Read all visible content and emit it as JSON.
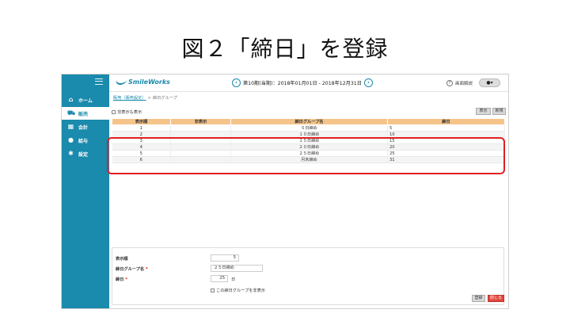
{
  "slide": {
    "title": "図２「締日」を登録"
  },
  "sidebar": {
    "items": [
      {
        "label": "ホーム",
        "icon": "home-icon"
      },
      {
        "label": "販売",
        "icon": "cart-icon"
      },
      {
        "label": "会計",
        "icon": "calculator-icon"
      },
      {
        "label": "給与",
        "icon": "money-bag-icon"
      },
      {
        "label": "設定",
        "icon": "gear-icon"
      }
    ],
    "active_index": 1
  },
  "header": {
    "logo": "SmileWorks",
    "period": "第10期(当期)：2018年01月01日 - 2018年12月31日",
    "help_label": "画面解説",
    "user_label": "▾"
  },
  "breadcrumb": {
    "parent": "販売（販売設定）",
    "separator": ">",
    "current": "締日グループ"
  },
  "toolbar": {
    "show_hidden_label": "非表示も表示",
    "display_label": "表示",
    "new_label": "新規"
  },
  "table": {
    "headers": [
      "表示順",
      "非表示",
      "締日グループ名",
      "締日"
    ],
    "rows": [
      {
        "order": "1",
        "hidden": "",
        "name": "５日締め",
        "day": "5"
      },
      {
        "order": "2",
        "hidden": "",
        "name": "１０日締め",
        "day": "10"
      },
      {
        "order": "3",
        "hidden": "",
        "name": "１５日締め",
        "day": "15"
      },
      {
        "order": "4",
        "hidden": "",
        "name": "２０日締め",
        "day": "20"
      },
      {
        "order": "5",
        "hidden": "",
        "name": "２５日締め",
        "day": "25"
      },
      {
        "order": "6",
        "hidden": "",
        "name": "月末締め",
        "day": "31"
      }
    ]
  },
  "form": {
    "order_label": "表示順",
    "order_value": "5",
    "name_label": "締日グループ名",
    "name_value": "２５日締め",
    "day_label": "締日",
    "day_value": "25",
    "day_unit": "日",
    "required_mark": "*",
    "hide_label": "この締日グループを非表示",
    "register_label": "登録",
    "close_label": "閉じる"
  },
  "colors": {
    "sidebar": "#1a8aad",
    "table_header": "#f5c48a",
    "highlight": "#e02020",
    "close_button": "#e0463c"
  }
}
